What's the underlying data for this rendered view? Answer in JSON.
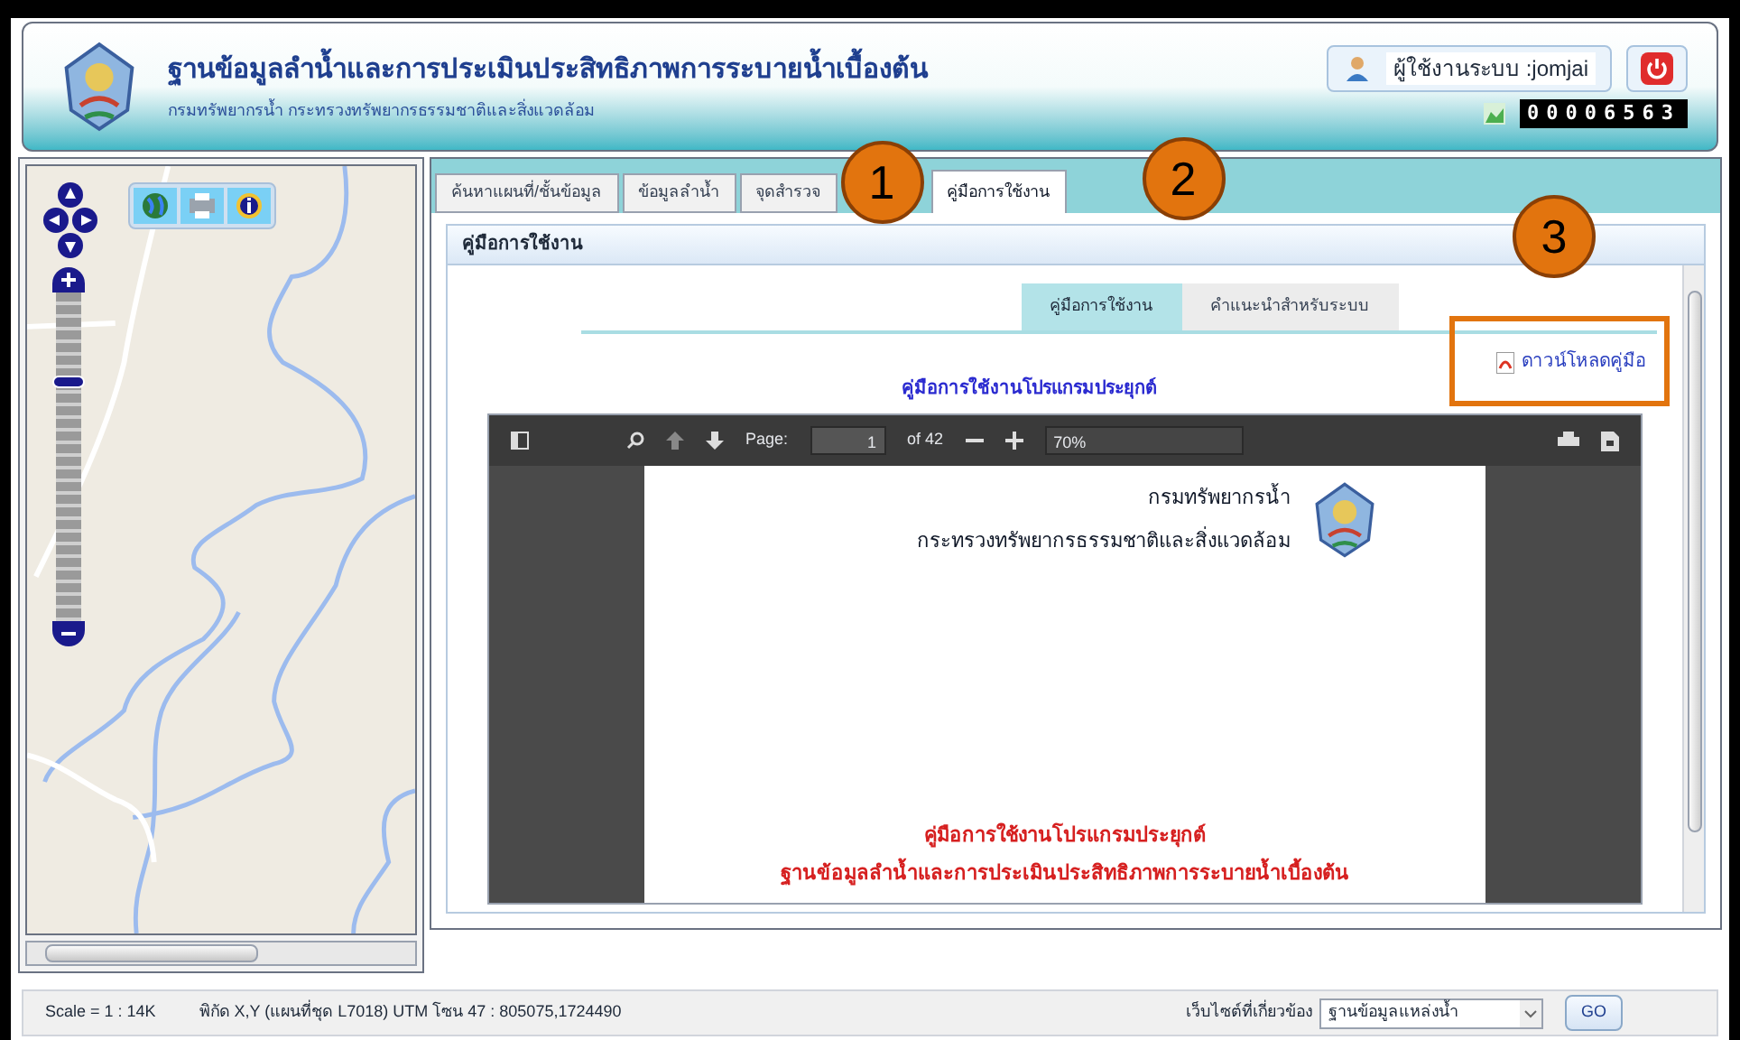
{
  "header": {
    "title": "ฐานข้อมูลลำน้ำและการประเมินประสิทธิภาพการระบายน้ำเบื้องต้น",
    "subtitle": "กรมทรัพยากรน้ำ  กระทรวงทรัพยากรธรรมชาติและสิ่งแวดล้อม",
    "user": "ผู้ใช้งานระบบ :jomjai",
    "visitor_counter": "00006563"
  },
  "map": {
    "zoom_slider": {
      "level": 0.75
    }
  },
  "tabs": [
    {
      "label": "ค้นหาแผนที่/ชั้นข้อมูล",
      "selected": false
    },
    {
      "label": "ข้อมูลลำน้ำ",
      "selected": false
    },
    {
      "label": "จุดสำรวจ",
      "selected": false
    },
    {
      "label": "คู่มือการใช้งาน",
      "selected": true
    }
  ],
  "panel": {
    "title": "คู่มือการใช้งาน",
    "subtabs": [
      {
        "label": "คู่มือการใช้งาน",
        "selected": true
      },
      {
        "label": "คำแนะนำสำหรับระบบ",
        "selected": false
      }
    ],
    "download_link": "ดาวน์โหลดคู่มือ",
    "heading": "คู่มือการใช้งานโปรแกรมประยุกต์",
    "pdf": {
      "page_label": "Page:",
      "page": "1",
      "page_count": "of 42",
      "zoom": "70%",
      "org_lines": [
        "กรมทรัพยากรน้ำ",
        "กระทรวงทรัพยากรธรรมชาติและสิ่งแวดล้อม"
      ],
      "title_lines": [
        "คู่มือการใช้งานโปรแกรมประยุกต์",
        "ฐานข้อมูลลำน้ำและการประเมินประสิทธิภาพการระบายน้ำเบื้องต้น"
      ]
    }
  },
  "annotations": [
    "1",
    "2",
    "3"
  ],
  "status_bar": {
    "scale": "Scale = 1 : 14K",
    "coordinates": "พิกัด X,Y (แผนที่ชุด L7018) UTM โซน 47 : 805075,1724490",
    "related_sites_label": "เว็บไซต์ที่เกี่ยวข้อง",
    "site_select": "ฐานข้อมูลแหล่งน้ำ",
    "go": "GO"
  }
}
